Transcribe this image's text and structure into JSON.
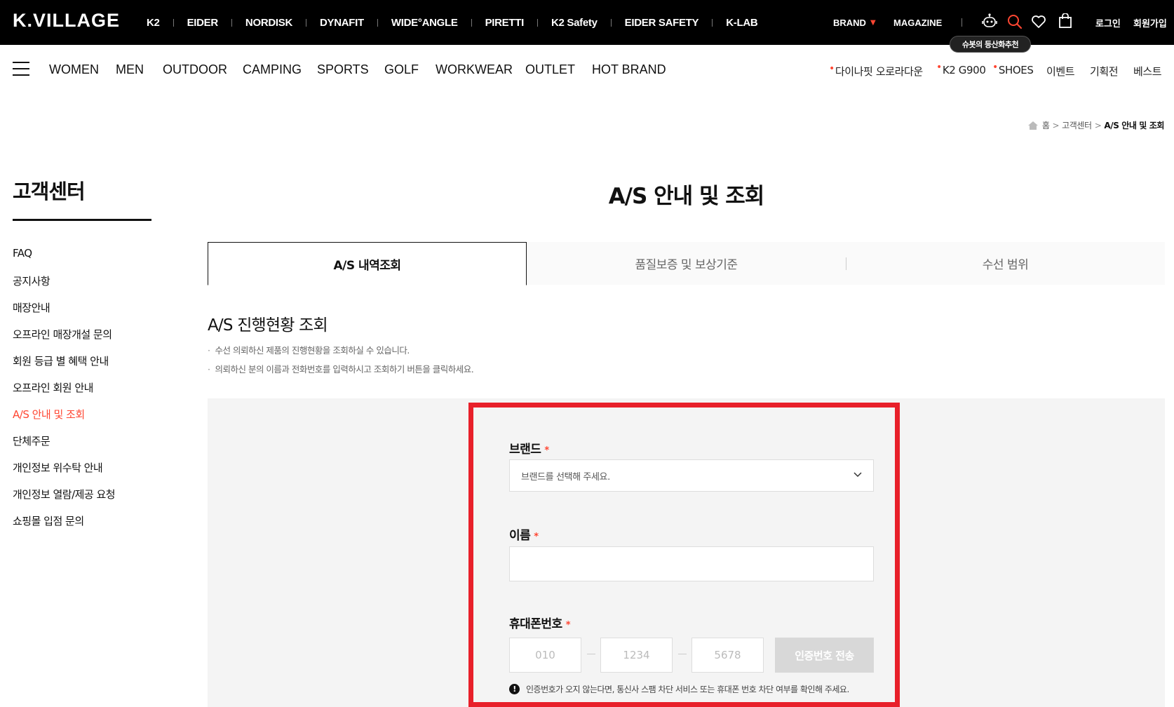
{
  "header": {
    "logo": "K.VILLAGE",
    "brands": [
      "K2",
      "EIDER",
      "NORDISK",
      "DYNAFIT",
      "WIDE°ANGLE",
      "PIRETTI",
      "K2 Safety",
      "EIDER SAFETY",
      "K-LAB"
    ],
    "brand_menu": "BRAND",
    "brand_menu_arrow": "▼",
    "magazine": "MAGAZINE",
    "login": "로그인",
    "signup": "회원가입",
    "tooltip": "슈봇의 등산화추천"
  },
  "nav": {
    "categories": [
      "WOMEN",
      "MEN",
      "OUTDOOR",
      "CAMPING",
      "SPORTS",
      "GOLF",
      "WORKWEAR",
      "OUTLET",
      "HOT BRAND"
    ],
    "quick_links": [
      {
        "label": "다이나핏 오로라다운",
        "dot": "•"
      },
      {
        "label": "K2 G900",
        "dot": "•"
      },
      {
        "label": "SHOES",
        "dot": "•"
      },
      {
        "label": "이벤트",
        "dot": ""
      },
      {
        "label": "기획전",
        "dot": ""
      },
      {
        "label": "베스트",
        "dot": ""
      }
    ]
  },
  "breadcrumb": {
    "home": "홈",
    "sep": ">",
    "level1": "고객센터",
    "current": "A/S 안내 및 조회"
  },
  "sidebar": {
    "title": "고객센터",
    "items": [
      "FAQ",
      "공지사항",
      "매장안내",
      "오프라인 매장개설 문의",
      "회원 등급 별 혜택 안내",
      "오프라인 회원 안내",
      "A/S 안내 및 조회",
      "단체주문",
      "개인정보 위수탁 안내",
      "개인정보 열람/제공 요청",
      "쇼핑몰 입점 문의"
    ],
    "active_index": 6
  },
  "main": {
    "title": "A/S 안내 및 조회",
    "tabs": [
      "A/S 내역조회",
      "품질보증 및 보상기준",
      "수선 범위"
    ],
    "section_title": "A/S 진행현황 조회",
    "notes": [
      "수선 의뢰하신 제품의 진행현황을 조회하실 수 있습니다.",
      "의뢰하신 분의 이름과 전화번호를 입력하시고 조회하기 버튼을 클릭하세요."
    ]
  },
  "form": {
    "required_mark": "*",
    "brand_label": "브랜드",
    "brand_placeholder": "브랜드를 선택해 주세요.",
    "name_label": "이름",
    "name_value": "",
    "phone_label": "휴대폰번호",
    "phone_placeholders": [
      "010",
      "1234",
      "5678"
    ],
    "send_button": "인증번호 전송",
    "warning_mark": "!",
    "warning": "인증번호가 오지 않는다면, 통신사 스팸 차단 서비스 또는 휴대폰 번호 차단 여부를 확인해 주세요."
  },
  "colors": {
    "accent": "#ff4632",
    "highlight_border": "#e8202a",
    "top_bar": "#000000"
  }
}
